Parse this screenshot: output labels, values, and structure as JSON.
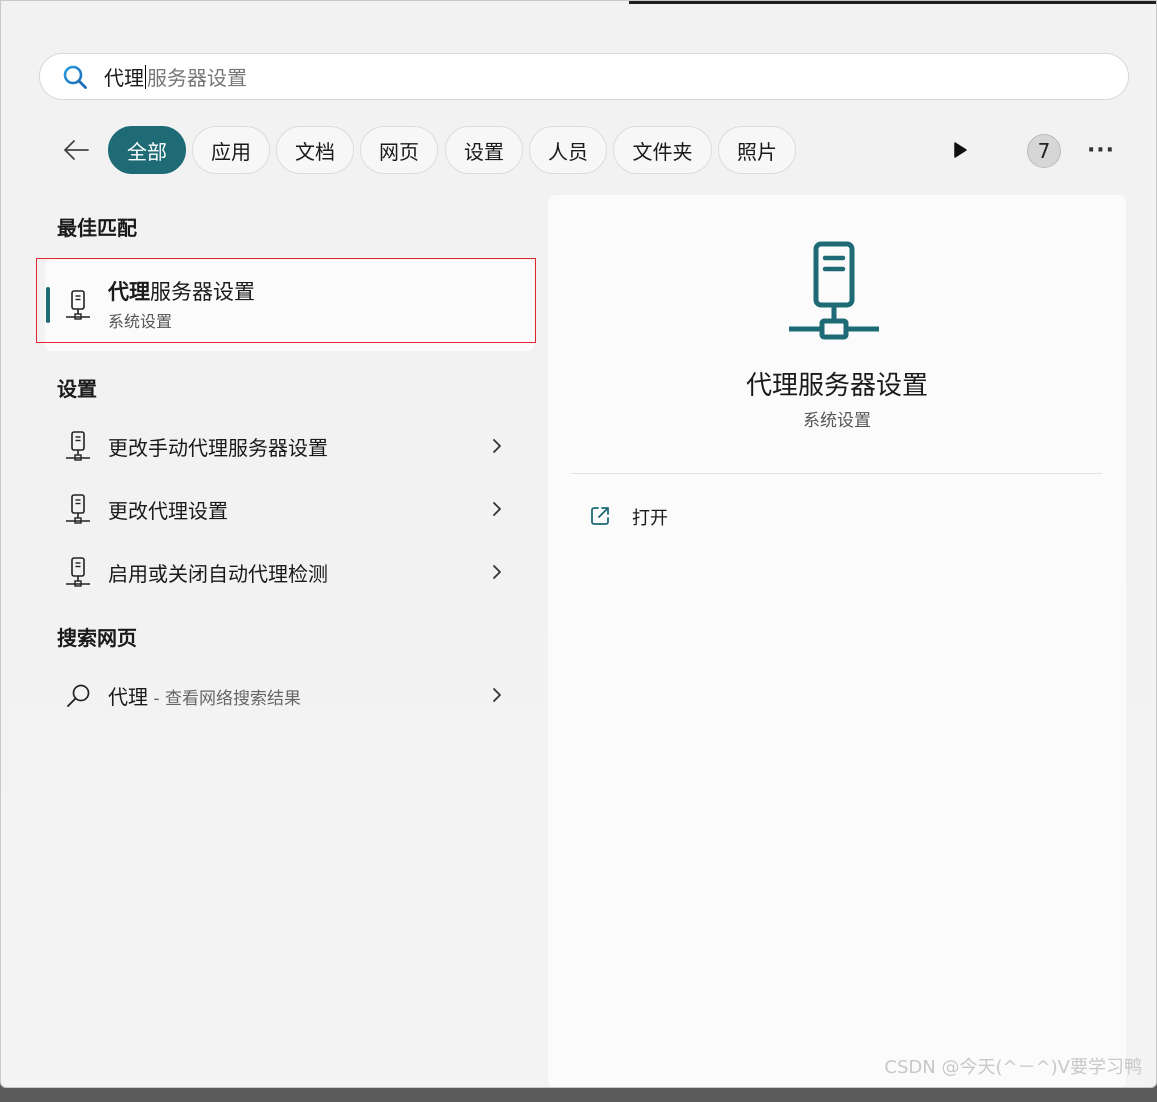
{
  "search": {
    "typed": "代理",
    "suggestion": "服务器设置"
  },
  "filters": {
    "back_label": "",
    "chips": [
      {
        "label": "全部",
        "active": true
      },
      {
        "label": "应用"
      },
      {
        "label": "文档"
      },
      {
        "label": "网页"
      },
      {
        "label": "设置"
      },
      {
        "label": "人员"
      },
      {
        "label": "文件夹"
      },
      {
        "label": "照片"
      }
    ],
    "count_badge": "7",
    "more_label": "···"
  },
  "left": {
    "best_match_heading": "最佳匹配",
    "best_match": {
      "title_bold": "代理",
      "title_rest": "服务器设置",
      "subtitle": "系统设置",
      "icon": "proxy-server-icon"
    },
    "settings_heading": "设置",
    "settings_items": [
      {
        "label": "更改手动代理服务器设置",
        "icon": "proxy-server-icon"
      },
      {
        "label": "更改代理设置",
        "icon": "proxy-server-icon"
      },
      {
        "label": "启用或关闭自动代理检测",
        "icon": "proxy-server-icon"
      }
    ],
    "web_heading": "搜索网页",
    "web_item": {
      "label": "代理",
      "suffix": " - 查看网络搜索结果",
      "icon": "search-icon"
    }
  },
  "preview": {
    "title": "代理服务器设置",
    "subtitle": "系统设置",
    "action_label": "打开",
    "icon": "proxy-server-icon"
  },
  "watermark": "CSDN @今天(^－^)V要学习鸭",
  "colors": {
    "accent": "#1e6b76",
    "highlight_outline": "#e0262e"
  }
}
